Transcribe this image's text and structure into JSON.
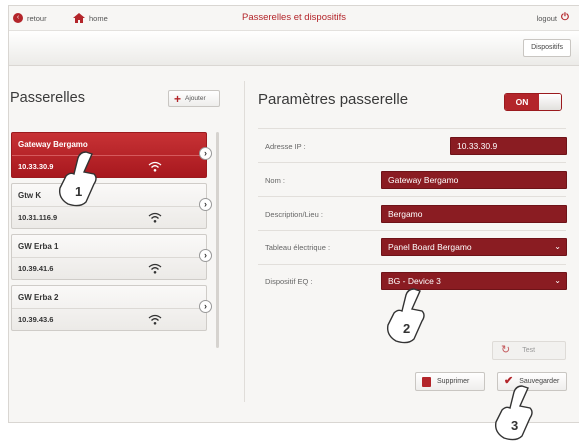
{
  "header": {
    "back_label": "retour",
    "home_label": "home",
    "title": "Passerelles et dispositifs",
    "logout_label": "logout",
    "dispositifs_label": "Dispositifs"
  },
  "left": {
    "title": "Passerelles",
    "add_label": "Ajouter",
    "gateways": [
      {
        "name": "Gateway Bergamo",
        "ip": "10.33.30.9",
        "active": true
      },
      {
        "name": "Gtw K",
        "ip": "10.31.116.9",
        "active": false
      },
      {
        "name": "GW Erba 1",
        "ip": "10.39.41.6",
        "active": false
      },
      {
        "name": "GW Erba 2",
        "ip": "10.39.43.6",
        "active": false
      }
    ]
  },
  "right": {
    "title": "Paramètres passerelle",
    "toggle_label": "ON",
    "toggle_state": "on",
    "fields": {
      "ip_label": "Adresse IP :",
      "ip_value": "10.33.30.9",
      "name_label": "Nom :",
      "name_value": "Gateway Bergamo",
      "desc_label": "Description/Lieu :",
      "desc_value": "Bergamo",
      "panel_label": "Tableau électrique :",
      "panel_value": "Panel Board Bergamo",
      "device_label": "Dispositif EQ :",
      "device_value": "BG - Device 3"
    },
    "test_label": "Test",
    "delete_label": "Supprimer",
    "save_label": "Sauvegarder"
  },
  "callouts": [
    "1",
    "2",
    "3"
  ],
  "colors": {
    "accent": "#b3252a",
    "field_bg": "#8a1c22",
    "page_bg": "#f7f6f4"
  }
}
